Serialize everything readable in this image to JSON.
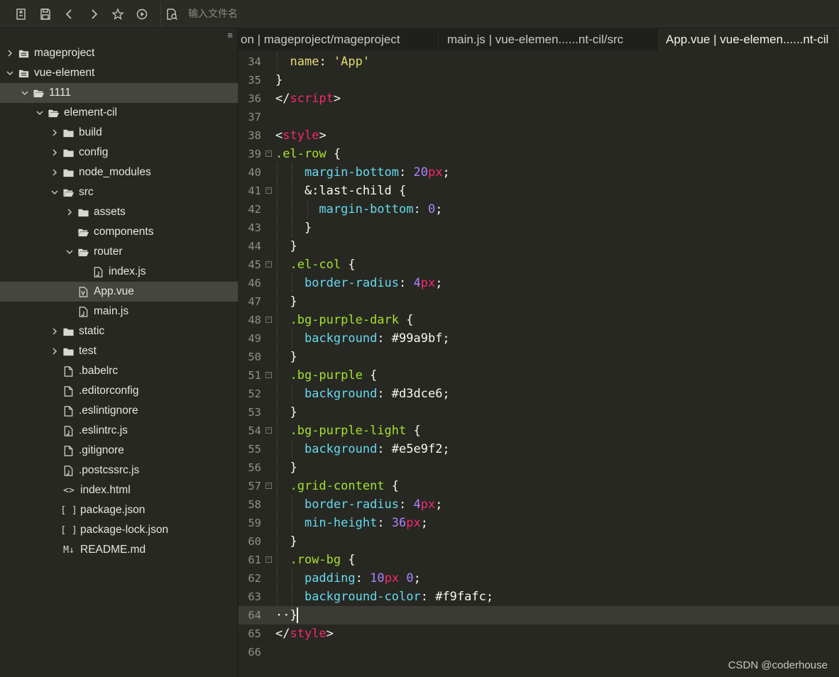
{
  "toolbar": {
    "search_placeholder": "输入文件名"
  },
  "sidebar": {
    "tree": [
      {
        "label": "mageproject",
        "depth": 0,
        "type": "project",
        "state": "collapsed"
      },
      {
        "label": "vue-element",
        "depth": 0,
        "type": "project",
        "state": "expanded"
      },
      {
        "label": "1111",
        "depth": 1,
        "type": "folder-open",
        "state": "expanded",
        "selected": true
      },
      {
        "label": "element-cil",
        "depth": 2,
        "type": "folder-open",
        "state": "expanded"
      },
      {
        "label": "build",
        "depth": 3,
        "type": "folder",
        "state": "collapsed"
      },
      {
        "label": "config",
        "depth": 3,
        "type": "folder",
        "state": "collapsed"
      },
      {
        "label": "node_modules",
        "depth": 3,
        "type": "folder",
        "state": "collapsed"
      },
      {
        "label": "src",
        "depth": 3,
        "type": "folder-open",
        "state": "expanded"
      },
      {
        "label": "assets",
        "depth": 4,
        "type": "folder",
        "state": "collapsed"
      },
      {
        "label": "components",
        "depth": 4,
        "type": "folder-open",
        "state": "none"
      },
      {
        "label": "router",
        "depth": 4,
        "type": "folder-open",
        "state": "expanded"
      },
      {
        "label": "index.js",
        "depth": 5,
        "type": "js",
        "state": "none"
      },
      {
        "label": "App.vue",
        "depth": 4,
        "type": "vue",
        "state": "none",
        "selected": true
      },
      {
        "label": "main.js",
        "depth": 4,
        "type": "js",
        "state": "none"
      },
      {
        "label": "static",
        "depth": 3,
        "type": "folder",
        "state": "collapsed"
      },
      {
        "label": "test",
        "depth": 3,
        "type": "folder",
        "state": "collapsed"
      },
      {
        "label": ".babelrc",
        "depth": 3,
        "type": "file",
        "state": "none"
      },
      {
        "label": ".editorconfig",
        "depth": 3,
        "type": "file",
        "state": "none"
      },
      {
        "label": ".eslintignore",
        "depth": 3,
        "type": "file",
        "state": "none"
      },
      {
        "label": ".eslintrc.js",
        "depth": 3,
        "type": "js",
        "state": "none"
      },
      {
        "label": ".gitignore",
        "depth": 3,
        "type": "file",
        "state": "none"
      },
      {
        "label": ".postcssrc.js",
        "depth": 3,
        "type": "js",
        "state": "none"
      },
      {
        "label": "index.html",
        "depth": 3,
        "type": "html",
        "state": "none"
      },
      {
        "label": "package.json",
        "depth": 3,
        "type": "json",
        "state": "none"
      },
      {
        "label": "package-lock.json",
        "depth": 3,
        "type": "json",
        "state": "none"
      },
      {
        "label": "README.md",
        "depth": 3,
        "type": "md",
        "state": "none"
      }
    ]
  },
  "icons": {
    "html_glyph": "<>",
    "json_glyph": "[ ]",
    "md_glyph": "M↓"
  },
  "tabs": [
    {
      "label": "on | mageproject/mageproject",
      "active": false
    },
    {
      "label": "main.js | vue-elemen......nt-cil/src",
      "active": false
    },
    {
      "label": "App.vue | vue-elemen......nt-cil",
      "active": true
    }
  ],
  "editor": {
    "current_line": 64,
    "lines": [
      {
        "n": 34,
        "fold": false,
        "guides": 1,
        "tokens": [
          [
            "  ",
            ""
          ],
          [
            "name",
            "k-name"
          ],
          [
            ": ",
            ""
          ],
          [
            "'App'",
            "k-str"
          ]
        ]
      },
      {
        "n": 35,
        "fold": false,
        "guides": 0,
        "tokens": [
          [
            "}",
            ""
          ]
        ]
      },
      {
        "n": 36,
        "fold": false,
        "guides": 0,
        "tokens": [
          [
            "</",
            ""
          ],
          [
            "script",
            "k-tag"
          ],
          [
            ">",
            ""
          ]
        ]
      },
      {
        "n": 37,
        "fold": false,
        "guides": 0,
        "tokens": []
      },
      {
        "n": 38,
        "fold": false,
        "guides": 0,
        "tokens": [
          [
            "<",
            ""
          ],
          [
            "style",
            "k-tag"
          ],
          [
            ">",
            ""
          ]
        ]
      },
      {
        "n": 39,
        "fold": true,
        "guides": 0,
        "tokens": [
          [
            ".el-row",
            "k-sel"
          ],
          [
            " {",
            ""
          ]
        ]
      },
      {
        "n": 40,
        "fold": false,
        "guides": 2,
        "tokens": [
          [
            "    ",
            ""
          ],
          [
            "margin-bottom",
            "k-prop"
          ],
          [
            ": ",
            ""
          ],
          [
            "20",
            "k-num"
          ],
          [
            "px",
            "k-unit"
          ],
          [
            ";",
            ""
          ]
        ]
      },
      {
        "n": 41,
        "fold": true,
        "guides": 2,
        "tokens": [
          [
            "    &:last-child {",
            ""
          ]
        ]
      },
      {
        "n": 42,
        "fold": false,
        "guides": 3,
        "tokens": [
          [
            "      ",
            ""
          ],
          [
            "margin-bottom",
            "k-prop"
          ],
          [
            ": ",
            ""
          ],
          [
            "0",
            "k-num"
          ],
          [
            ";",
            ""
          ]
        ]
      },
      {
        "n": 43,
        "fold": false,
        "guides": 2,
        "tokens": [
          [
            "    }",
            ""
          ]
        ]
      },
      {
        "n": 44,
        "fold": false,
        "guides": 1,
        "tokens": [
          [
            "  }",
            ""
          ]
        ]
      },
      {
        "n": 45,
        "fold": true,
        "guides": 1,
        "tokens": [
          [
            "  ",
            ""
          ],
          [
            ".el-col",
            "k-sel"
          ],
          [
            " {",
            ""
          ]
        ]
      },
      {
        "n": 46,
        "fold": false,
        "guides": 2,
        "tokens": [
          [
            "    ",
            ""
          ],
          [
            "border-radius",
            "k-prop"
          ],
          [
            ": ",
            ""
          ],
          [
            "4",
            "k-num"
          ],
          [
            "px",
            "k-unit"
          ],
          [
            ";",
            ""
          ]
        ]
      },
      {
        "n": 47,
        "fold": false,
        "guides": 1,
        "tokens": [
          [
            "  }",
            ""
          ]
        ]
      },
      {
        "n": 48,
        "fold": true,
        "guides": 1,
        "tokens": [
          [
            "  ",
            ""
          ],
          [
            ".bg-purple-dark",
            "k-sel"
          ],
          [
            " {",
            ""
          ]
        ]
      },
      {
        "n": 49,
        "fold": false,
        "guides": 2,
        "tokens": [
          [
            "    ",
            ""
          ],
          [
            "background",
            "k-prop"
          ],
          [
            ": #99a9bf;",
            ""
          ]
        ]
      },
      {
        "n": 50,
        "fold": false,
        "guides": 1,
        "tokens": [
          [
            "  }",
            ""
          ]
        ]
      },
      {
        "n": 51,
        "fold": true,
        "guides": 1,
        "tokens": [
          [
            "  ",
            ""
          ],
          [
            ".bg-purple",
            "k-sel"
          ],
          [
            " {",
            ""
          ]
        ]
      },
      {
        "n": 52,
        "fold": false,
        "guides": 2,
        "tokens": [
          [
            "    ",
            ""
          ],
          [
            "background",
            "k-prop"
          ],
          [
            ": #d3dce6;",
            ""
          ]
        ]
      },
      {
        "n": 53,
        "fold": false,
        "guides": 1,
        "tokens": [
          [
            "  }",
            ""
          ]
        ]
      },
      {
        "n": 54,
        "fold": true,
        "guides": 1,
        "tokens": [
          [
            "  ",
            ""
          ],
          [
            ".bg-purple-light",
            "k-sel"
          ],
          [
            " {",
            ""
          ]
        ]
      },
      {
        "n": 55,
        "fold": false,
        "guides": 2,
        "tokens": [
          [
            "    ",
            ""
          ],
          [
            "background",
            "k-prop"
          ],
          [
            ": #e5e9f2;",
            ""
          ]
        ]
      },
      {
        "n": 56,
        "fold": false,
        "guides": 1,
        "tokens": [
          [
            "  }",
            ""
          ]
        ]
      },
      {
        "n": 57,
        "fold": true,
        "guides": 1,
        "tokens": [
          [
            "  ",
            ""
          ],
          [
            ".grid-content",
            "k-sel"
          ],
          [
            " {",
            ""
          ]
        ]
      },
      {
        "n": 58,
        "fold": false,
        "guides": 2,
        "tokens": [
          [
            "    ",
            ""
          ],
          [
            "border-radius",
            "k-prop"
          ],
          [
            ": ",
            ""
          ],
          [
            "4",
            "k-num"
          ],
          [
            "px",
            "k-unit"
          ],
          [
            ";",
            ""
          ]
        ]
      },
      {
        "n": 59,
        "fold": false,
        "guides": 2,
        "tokens": [
          [
            "    ",
            ""
          ],
          [
            "min-height",
            "k-prop"
          ],
          [
            ": ",
            ""
          ],
          [
            "36",
            "k-num"
          ],
          [
            "px",
            "k-unit"
          ],
          [
            ";",
            ""
          ]
        ]
      },
      {
        "n": 60,
        "fold": false,
        "guides": 1,
        "tokens": [
          [
            "  }",
            ""
          ]
        ]
      },
      {
        "n": 61,
        "fold": true,
        "guides": 1,
        "tokens": [
          [
            "  ",
            ""
          ],
          [
            ".row-bg",
            "k-sel"
          ],
          [
            " {",
            ""
          ]
        ]
      },
      {
        "n": 62,
        "fold": false,
        "guides": 2,
        "tokens": [
          [
            "    ",
            ""
          ],
          [
            "padding",
            "k-prop"
          ],
          [
            ": ",
            ""
          ],
          [
            "10",
            "k-num"
          ],
          [
            "px",
            "k-unit"
          ],
          [
            " ",
            ""
          ],
          [
            "0",
            "k-num"
          ],
          [
            ";",
            ""
          ]
        ]
      },
      {
        "n": 63,
        "fold": false,
        "guides": 2,
        "tokens": [
          [
            "    ",
            ""
          ],
          [
            "background-color",
            "k-prop"
          ],
          [
            ": #f9fafc;",
            ""
          ]
        ]
      },
      {
        "n": 64,
        "fold": false,
        "guides": 0,
        "tokens": [
          [
            "··}",
            ""
          ]
        ]
      },
      {
        "n": 65,
        "fold": false,
        "guides": 0,
        "tokens": [
          [
            "</",
            ""
          ],
          [
            "style",
            "k-tag"
          ],
          [
            ">",
            ""
          ]
        ]
      },
      {
        "n": 66,
        "fold": false,
        "guides": 0,
        "tokens": []
      }
    ]
  },
  "watermark": "CSDN @coderhouse"
}
